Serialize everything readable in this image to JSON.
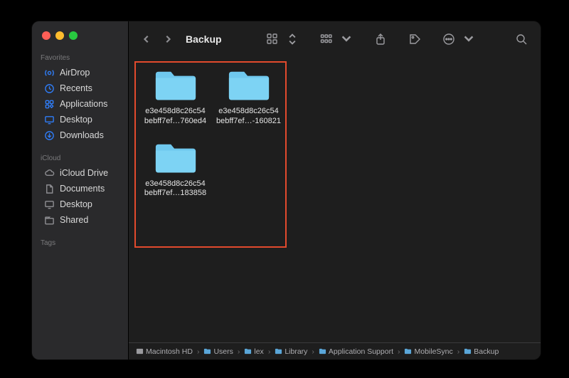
{
  "window_title": "Backup",
  "sidebar": {
    "sections": [
      {
        "label": "Favorites",
        "items": [
          {
            "icon": "airdrop",
            "label": "AirDrop"
          },
          {
            "icon": "clock",
            "label": "Recents"
          },
          {
            "icon": "apps",
            "label": "Applications"
          },
          {
            "icon": "desktop",
            "label": "Desktop"
          },
          {
            "icon": "download",
            "label": "Downloads"
          }
        ]
      },
      {
        "label": "iCloud",
        "items": [
          {
            "icon": "cloud",
            "label": "iCloud Drive"
          },
          {
            "icon": "doc",
            "label": "Documents"
          },
          {
            "icon": "desktop",
            "label": "Desktop"
          },
          {
            "icon": "shared",
            "label": "Shared"
          }
        ]
      },
      {
        "label": "Tags",
        "items": []
      }
    ]
  },
  "folders": [
    {
      "line1": "e3e458d8c26c54",
      "line2": "bebff7ef…760ed4"
    },
    {
      "line1": "e3e458d8c26c54",
      "line2": "bebff7ef…-160821"
    },
    {
      "line1": "e3e458d8c26c54",
      "line2": "bebff7ef…183858"
    }
  ],
  "path": [
    {
      "icon": "disk",
      "label": "Macintosh HD"
    },
    {
      "icon": "folder",
      "label": "Users"
    },
    {
      "icon": "folder",
      "label": "lex"
    },
    {
      "icon": "folder",
      "label": "Library"
    },
    {
      "icon": "folder",
      "label": "Application Support"
    },
    {
      "icon": "folder",
      "label": "MobileSync"
    },
    {
      "icon": "folder",
      "label": "Backup"
    }
  ]
}
